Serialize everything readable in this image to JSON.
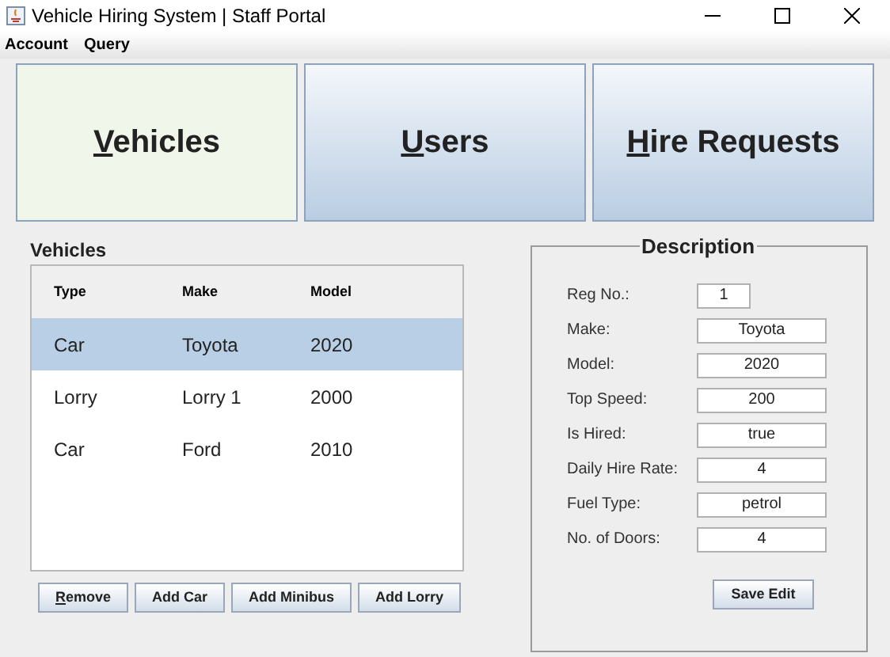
{
  "window": {
    "title": "Vehicle Hiring System | Staff Portal"
  },
  "menu": [
    "Account",
    "Query"
  ],
  "tabs": [
    {
      "label": "Vehicles",
      "selected": true,
      "mnemonic": true
    },
    {
      "label": "Users",
      "selected": false,
      "mnemonic": true
    },
    {
      "label": "Hire Requests",
      "selected": false,
      "mnemonic": true
    }
  ],
  "vehicles": {
    "title": "Vehicles",
    "columns": [
      "Type",
      "Make",
      "Model"
    ],
    "rows": [
      {
        "cells": [
          "Car",
          "Toyota",
          "2020"
        ],
        "selected": true
      },
      {
        "cells": [
          "Lorry",
          "Lorry 1",
          "2000"
        ],
        "selected": false
      },
      {
        "cells": [
          "Car",
          "Ford",
          "2010"
        ],
        "selected": false
      }
    ],
    "buttons": [
      {
        "label": "Remove",
        "mnemonic": true
      },
      {
        "label": "Add Car",
        "mnemonic": false
      },
      {
        "label": "Add Minibus",
        "mnemonic": false
      },
      {
        "label": "Add Lorry",
        "mnemonic": false
      }
    ]
  },
  "description": {
    "title": "Description",
    "fields": [
      {
        "label": "Reg No.:",
        "value": "1",
        "kind": "short"
      },
      {
        "label": "Make:",
        "value": "Toyota",
        "kind": "wide"
      },
      {
        "label": "Model:",
        "value": "2020",
        "kind": "wide"
      },
      {
        "label": "Top Speed:",
        "value": "200",
        "kind": "wide"
      },
      {
        "label": "Is Hired:",
        "value": "true",
        "kind": "wide"
      },
      {
        "label": "Daily Hire Rate:",
        "value": "4",
        "kind": "wide"
      },
      {
        "label": "Fuel Type:",
        "value": "petrol",
        "kind": "wide"
      },
      {
        "label": "No. of Doors:",
        "value": "4",
        "kind": "wide"
      }
    ],
    "button": "Save Edit"
  }
}
